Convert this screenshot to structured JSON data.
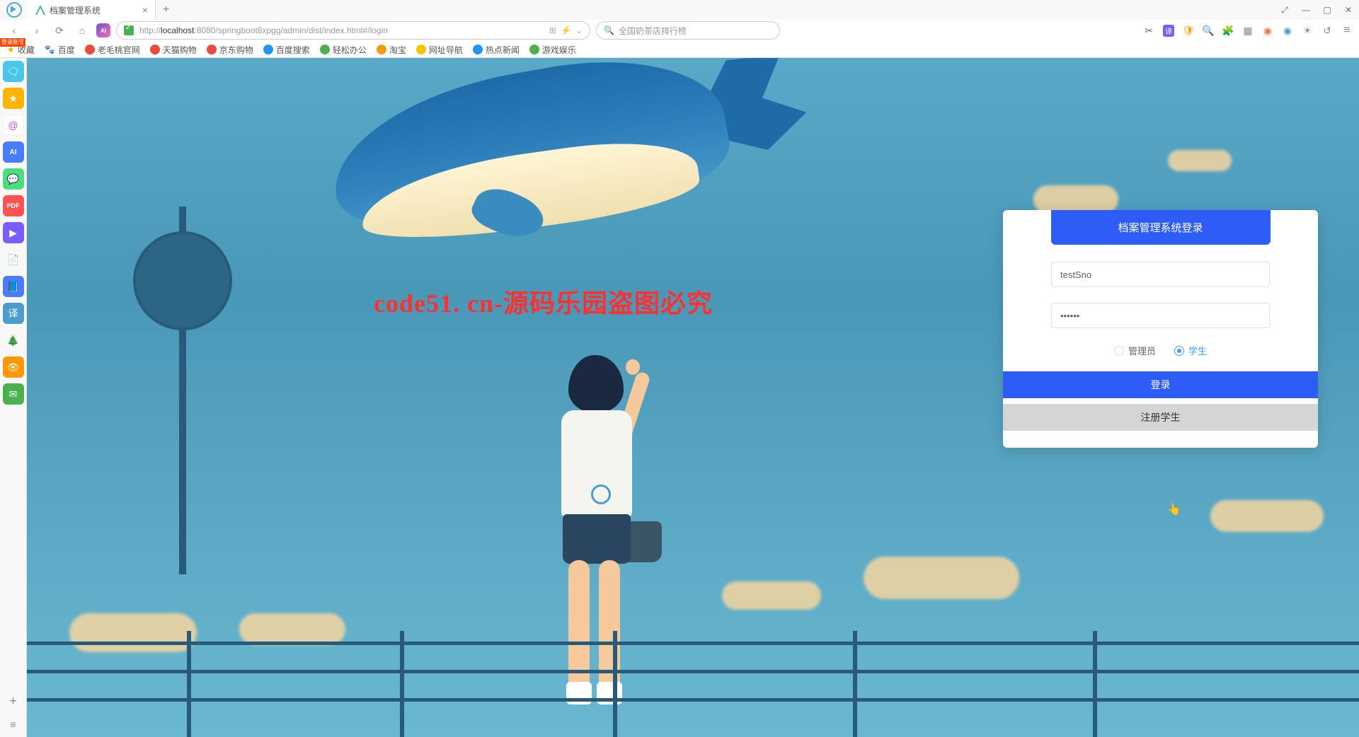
{
  "tab": {
    "title": "档案管理系统"
  },
  "window_controls": {
    "pin": "⤢",
    "min": "—",
    "max": "▢",
    "close": "✕"
  },
  "nav": {
    "back": "‹",
    "forward": "›",
    "reload": "⟳",
    "home": "⌂"
  },
  "url": {
    "prefix": "http://",
    "host": "localhost",
    "rest": ":8080/springboot8xpgg/admin/dist/index.html#/login"
  },
  "search": {
    "placeholder": "全国奶茶店排行榜"
  },
  "bookmarks": {
    "favorites": "收藏",
    "items": [
      "百度",
      "老毛桃官网",
      "天猫购物",
      "京东购物",
      "百度搜索",
      "轻松办公",
      "淘宝",
      "网址导航",
      "热点新闻",
      "游戏娱乐"
    ]
  },
  "sidebar_badge": "登录账号",
  "watermark": "code51. cn-源码乐园盗图必究",
  "login": {
    "title": "档案管理系统登录",
    "username_value": "testSno",
    "password_value": "••••••",
    "role_admin": "管理员",
    "role_student": "学生",
    "btn_login": "登录",
    "btn_register": "注册学生"
  }
}
